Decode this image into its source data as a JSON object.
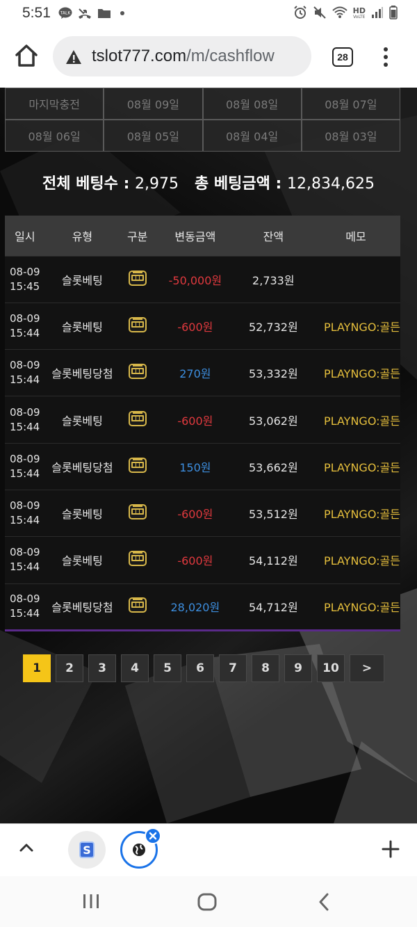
{
  "status_bar": {
    "time": "5:51",
    "notif_talk": "TALK",
    "hd_label": "HD",
    "voice_label": "VoLTE"
  },
  "browser": {
    "url_domain": "tslot777.com",
    "url_path": "/m/cashflow",
    "tab_count": "28"
  },
  "date_tabs": [
    "마지막충전",
    "08월 09일",
    "08월 08일",
    "08월 07일",
    "08월 06일",
    "08월 05일",
    "08월 04일",
    "08월 03일"
  ],
  "summary": {
    "bet_count_label": "전체 베팅수 : ",
    "bet_count": "2,975",
    "bet_amount_label": "총 베팅금액 : ",
    "bet_amount": "12,834,625"
  },
  "table": {
    "headers": [
      "일시",
      "유형",
      "구분",
      "변동금액",
      "잔액",
      "메모"
    ],
    "rows": [
      {
        "date": "08-09",
        "time": "15:45",
        "type": "슬롯베팅",
        "amount": "-50,000원",
        "sign": "neg",
        "balance": "2,733원",
        "memo": ""
      },
      {
        "date": "08-09",
        "time": "15:44",
        "type": "슬롯베팅",
        "amount": "-600원",
        "sign": "neg",
        "balance": "52,732원",
        "memo": "PLAYNGO:골든"
      },
      {
        "date": "08-09",
        "time": "15:44",
        "type": "슬롯베팅당첨",
        "amount": "270원",
        "sign": "pos",
        "balance": "53,332원",
        "memo": "PLAYNGO:골든"
      },
      {
        "date": "08-09",
        "time": "15:44",
        "type": "슬롯베팅",
        "amount": "-600원",
        "sign": "neg",
        "balance": "53,062원",
        "memo": "PLAYNGO:골든"
      },
      {
        "date": "08-09",
        "time": "15:44",
        "type": "슬롯베팅당첨",
        "amount": "150원",
        "sign": "pos",
        "balance": "53,662원",
        "memo": "PLAYNGO:골든"
      },
      {
        "date": "08-09",
        "time": "15:44",
        "type": "슬롯베팅",
        "amount": "-600원",
        "sign": "neg",
        "balance": "53,512원",
        "memo": "PLAYNGO:골든"
      },
      {
        "date": "08-09",
        "time": "15:44",
        "type": "슬롯베팅",
        "amount": "-600원",
        "sign": "neg",
        "balance": "54,112원",
        "memo": "PLAYNGO:골든"
      },
      {
        "date": "08-09",
        "time": "15:44",
        "type": "슬롯베팅당첨",
        "amount": "28,020원",
        "sign": "pos",
        "balance": "54,712원",
        "memo": "PLAYNGO:골든"
      }
    ]
  },
  "pagination": {
    "pages": [
      "1",
      "2",
      "3",
      "4",
      "5",
      "6",
      "7",
      "8",
      "9",
      "10"
    ],
    "active": "1",
    "next_label": ">"
  },
  "bottom_bar": {
    "tab1_letter": "S"
  },
  "colors": {
    "negative": "#e0393e",
    "positive": "#3d8fe0",
    "memo": "#e6bf3c",
    "pager_active": "#f5c518",
    "accent": "#1a73e8"
  },
  "icons": [
    "home-icon",
    "warning-icon",
    "menu-dots-icon",
    "slot-machine-icon",
    "chevron-up-icon",
    "globe-icon",
    "close-icon",
    "plus-icon",
    "recents-icon",
    "home-nav-icon",
    "back-icon"
  ]
}
